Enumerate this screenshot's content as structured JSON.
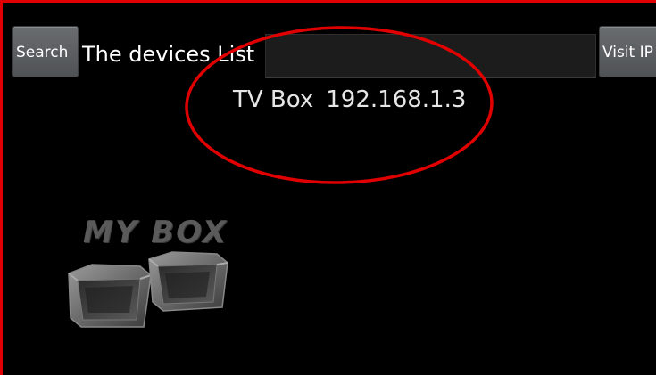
{
  "toolbar": {
    "search_label": "Search",
    "list_label": "The devices List",
    "ip_input_value": "",
    "visit_label": "Visit IP"
  },
  "devices": [
    {
      "name": "TV Box",
      "ip": "192.168.1.3"
    }
  ],
  "logo": {
    "text": "MY BOX"
  },
  "colors": {
    "highlight_ellipse": "#e00000",
    "background": "#000000"
  }
}
